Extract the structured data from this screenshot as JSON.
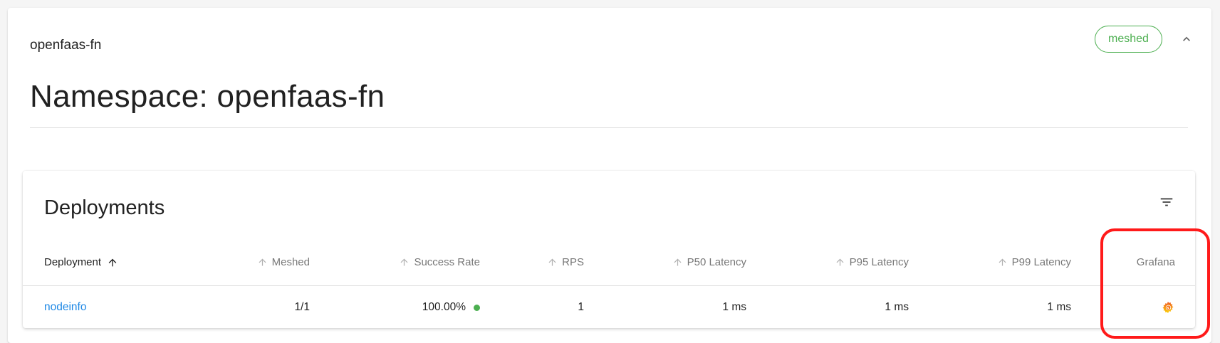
{
  "namespace": {
    "label": "openfaas-fn",
    "badge": "meshed",
    "title": "Namespace: openfaas-fn"
  },
  "deployments": {
    "title": "Deployments",
    "columns": {
      "deployment": "Deployment",
      "meshed": "Meshed",
      "success_rate": "Success Rate",
      "rps": "RPS",
      "p50": "P50 Latency",
      "p95": "P95 Latency",
      "p99": "P99 Latency",
      "grafana": "Grafana"
    },
    "rows": [
      {
        "name": "nodeinfo",
        "meshed": "1/1",
        "success_rate": "100.00%",
        "rps": "1",
        "p50": "1 ms",
        "p95": "1 ms",
        "p99": "1 ms",
        "grafana_icon": "grafana-icon"
      }
    ]
  },
  "colors": {
    "meshed_green": "#4caf50",
    "link_blue": "#1e88e5",
    "highlight_red": "#ff1a1a",
    "grafana_orange": "#f46800"
  }
}
